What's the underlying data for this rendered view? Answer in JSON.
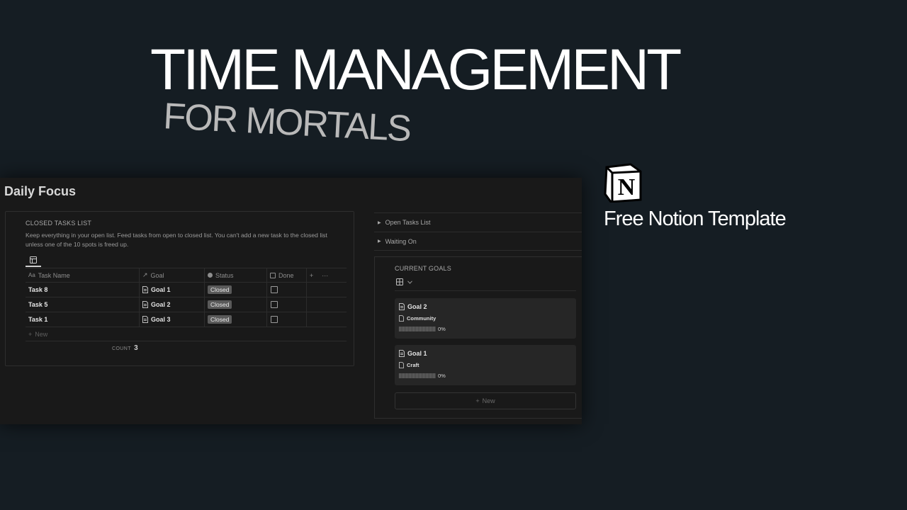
{
  "hero": {
    "title": "TIME MANAGEMENT",
    "subtitle": "FOR MORTALS"
  },
  "promo": {
    "logo_letter": "N",
    "caption": "Free Notion Template"
  },
  "page": {
    "title": "Daily Focus"
  },
  "closed_tasks": {
    "label": "CLOSED TASKS LIST",
    "description": "Keep everything in your open list. Feed tasks from open to closed list. You can't add a new task to the closed list unless one of the 10 spots is freed up.",
    "columns": {
      "task": "Task Name",
      "goal": "Goal",
      "status": "Status",
      "done": "Done",
      "add": "+",
      "more": "···"
    },
    "rows": [
      {
        "task": "Task 8",
        "goal": "Goal 1",
        "status": "Closed",
        "done": false
      },
      {
        "task": "Task 5",
        "goal": "Goal 2",
        "status": "Closed",
        "done": false
      },
      {
        "task": "Task 1",
        "goal": "Goal 3",
        "status": "Closed",
        "done": false
      }
    ],
    "new_label": "New",
    "count_label": "COUNT",
    "count_value": "3"
  },
  "toggles": [
    {
      "label": "Open Tasks List"
    },
    {
      "label": "Waiting On"
    }
  ],
  "current_goals": {
    "label": "CURRENT GOALS",
    "cards": [
      {
        "title": "Goal 2",
        "category": "Community",
        "progress_text": "0%",
        "progress": 0
      },
      {
        "title": "Goal 1",
        "category": "Craft",
        "progress_text": "0%",
        "progress": 0
      }
    ],
    "new_label": "New"
  },
  "icons": {
    "table_view": "table-icon",
    "gallery_view": "gallery-icon",
    "page": "page-icon",
    "toggle": "triangle-right-icon",
    "plus": "plus-icon"
  }
}
